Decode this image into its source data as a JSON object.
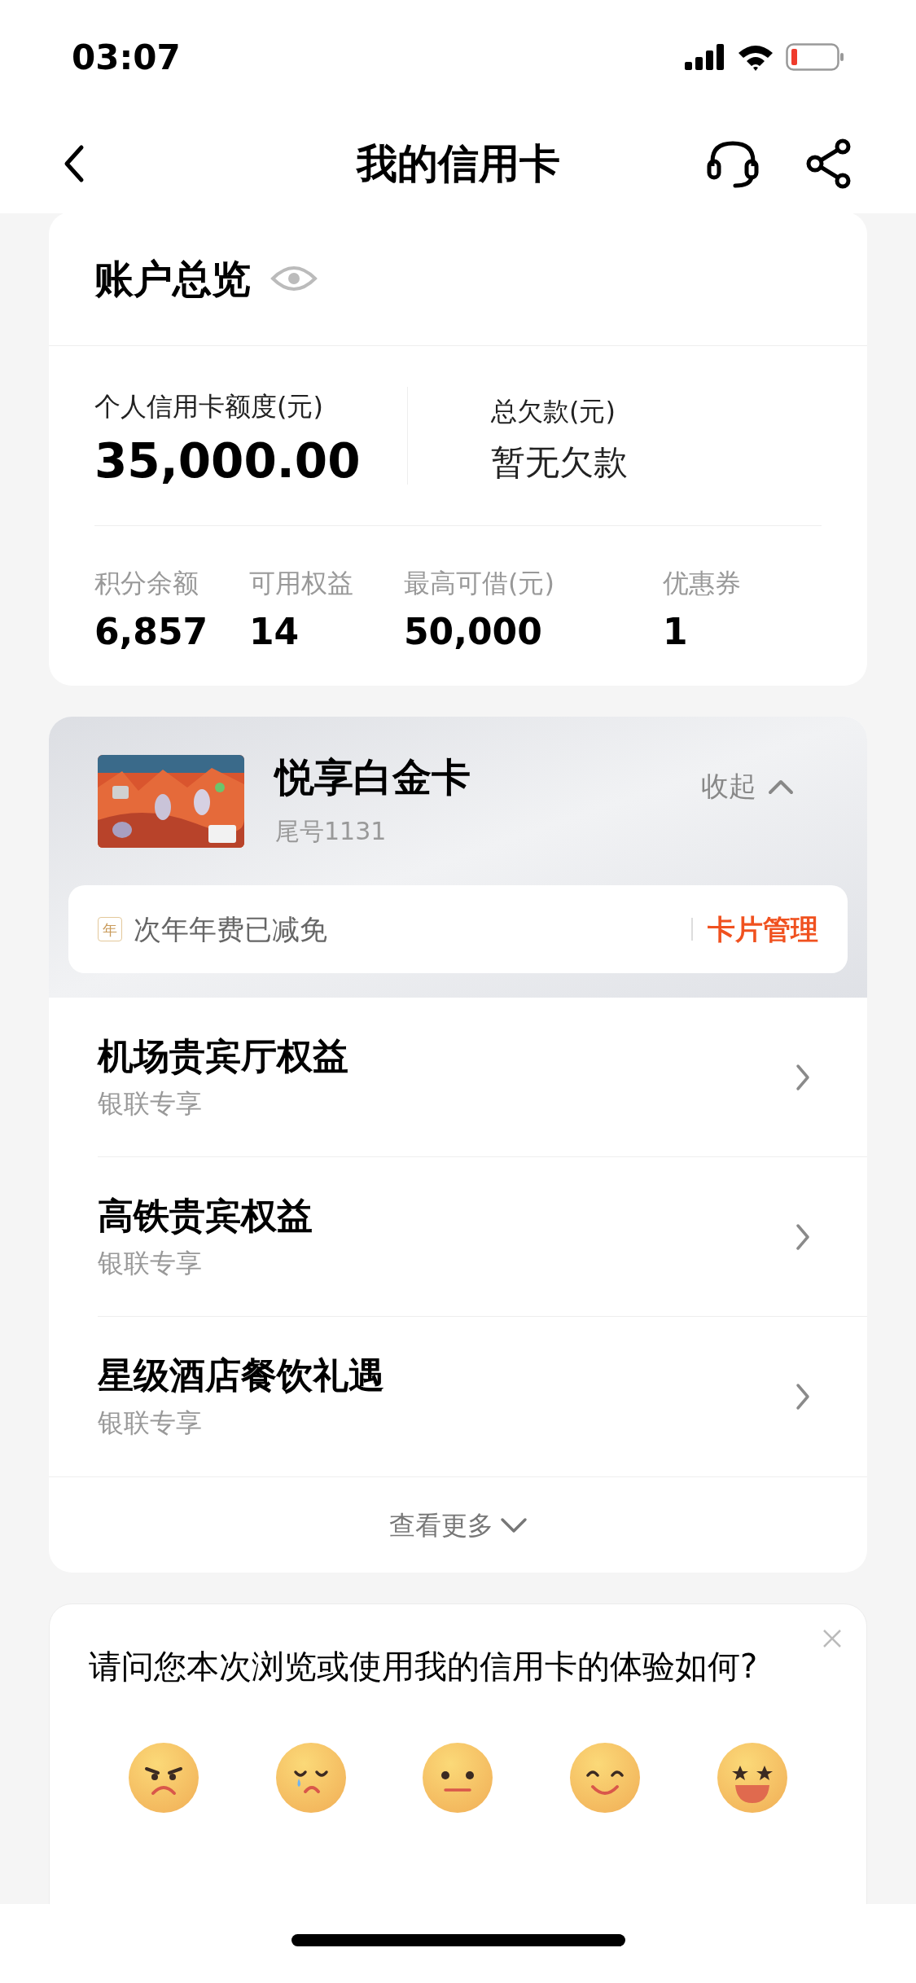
{
  "status_bar": {
    "time": "03:07"
  },
  "nav": {
    "title": "我的信用卡"
  },
  "overview": {
    "title": "账户总览",
    "credit_limit": {
      "label": "个人信用卡额度(元)",
      "value": "35,000.00"
    },
    "debt": {
      "label": "总欠款(元)",
      "value": "暂无欠款"
    },
    "stats": [
      {
        "label": "积分余额",
        "value": "6,857"
      },
      {
        "label": "可用权益",
        "value": "14"
      },
      {
        "label": "最高可借(元)",
        "value": "50,000"
      },
      {
        "label": "优惠券",
        "value": "1"
      }
    ]
  },
  "card": {
    "name": "悦享白金卡",
    "number": "尾号1131",
    "collapse": "收起",
    "badge": "年",
    "notice": "次年年费已减免",
    "manage": "卡片管理",
    "benefits": [
      {
        "title": "机场贵宾厅权益",
        "subtitle": "银联专享"
      },
      {
        "title": "高铁贵宾权益",
        "subtitle": "银联专享"
      },
      {
        "title": "星级酒店餐饮礼遇",
        "subtitle": "银联专享"
      }
    ],
    "more": "查看更多"
  },
  "survey": {
    "question": "请问您本次浏览或使用我的信用卡的体验如何?",
    "ratings": [
      {
        "kind": "angry"
      },
      {
        "kind": "crying"
      },
      {
        "kind": "neutral"
      },
      {
        "kind": "smile"
      },
      {
        "kind": "star"
      }
    ]
  }
}
